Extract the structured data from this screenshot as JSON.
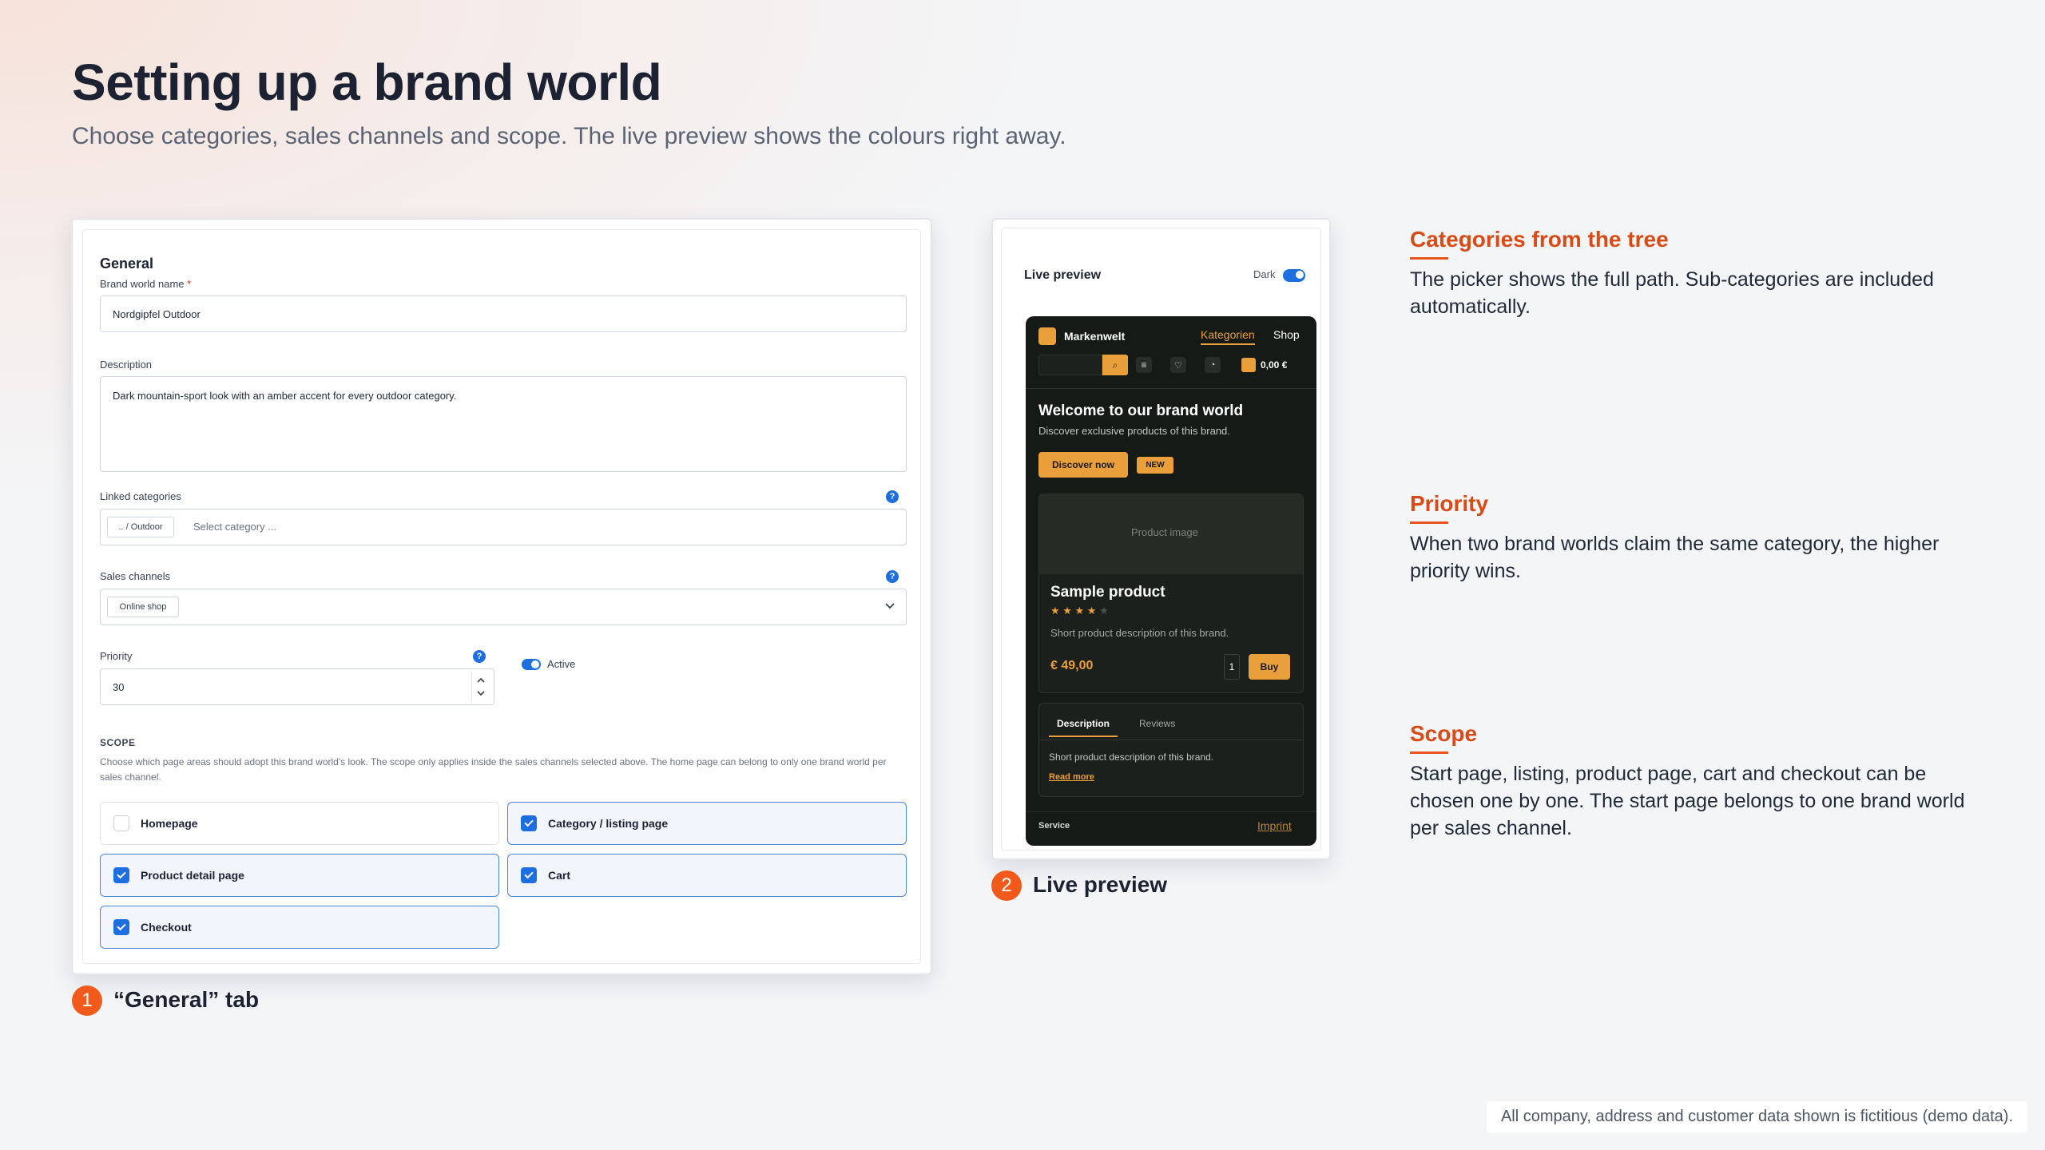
{
  "header": {
    "title": "Setting up a brand world",
    "subtitle": "Choose categories, sales channels and scope. The live preview shows the colours right away."
  },
  "form": {
    "section_title": "General",
    "name_label": "Brand world name",
    "required_mark": "*",
    "name_value": "Nordgipfel Outdoor",
    "description_label": "Description",
    "description_value": "Dark mountain-sport look with an amber accent for every outdoor category.",
    "categories_label": "Linked categories",
    "category_chip": ".. / Outdoor",
    "category_placeholder": "Select category ...",
    "channels_label": "Sales channels",
    "channel_chip": "Online shop",
    "priority_label": "Priority",
    "priority_value": "30",
    "active_label": "Active",
    "help_glyph": "?",
    "scope_title": "SCOPE",
    "scope_text": "Choose which page areas should adopt this brand world's look. The scope only applies inside the sales channels selected above. The home page can belong to only one brand world per sales channel.",
    "scope_items": [
      {
        "label": "Homepage",
        "checked": false
      },
      {
        "label": "Category / listing page",
        "checked": true
      },
      {
        "label": "Product detail page",
        "checked": true
      },
      {
        "label": "Cart",
        "checked": true
      },
      {
        "label": "Checkout",
        "checked": true
      }
    ]
  },
  "captions": {
    "general_number": "1",
    "general_tab": "“General” tab",
    "preview_number": "2",
    "preview": "Live preview"
  },
  "preview": {
    "title": "Live preview",
    "dark_label": "Dark",
    "shop_name": "Markenwelt",
    "nav_categories": "Kategorien",
    "nav_shop": "Shop",
    "search_glyph": "⌕",
    "menu_glyph": "≡",
    "heart_glyph": "♡",
    "user_glyph": "◔",
    "cart_total": "0,00 €",
    "hero_title": "Welcome to our brand world",
    "hero_text": "Discover exclusive products of this brand.",
    "cta": "Discover now",
    "badge": "NEW",
    "image_placeholder": "Product image",
    "product_name": "Sample product",
    "stars": "★ ★ ★ ★",
    "empty_star": "★",
    "rating": 4,
    "product_desc": "Short product description of this brand.",
    "price": "€ 49,00",
    "qty": "1",
    "buy": "Buy",
    "tab_description": "Description",
    "tab_reviews": "Reviews",
    "tab_text": "Short product description of this brand.",
    "read_more": "Read more",
    "footer_service": "Service",
    "footer_imprint": "Imprint",
    "accent_color": "#e9a03b"
  },
  "explanations": [
    {
      "title": "Categories from the tree",
      "text": "The picker shows the full path. Sub-categories are included automatically."
    },
    {
      "title": "Priority",
      "text": "When two brand worlds claim the same category, the higher priority wins."
    },
    {
      "title": "Scope",
      "text": "Start page, listing, product page, cart and checkout can be chosen one by one. The start page belongs to one brand world per sales channel."
    }
  ],
  "footnote": "All company, address and customer data shown is fictitious (demo data)."
}
